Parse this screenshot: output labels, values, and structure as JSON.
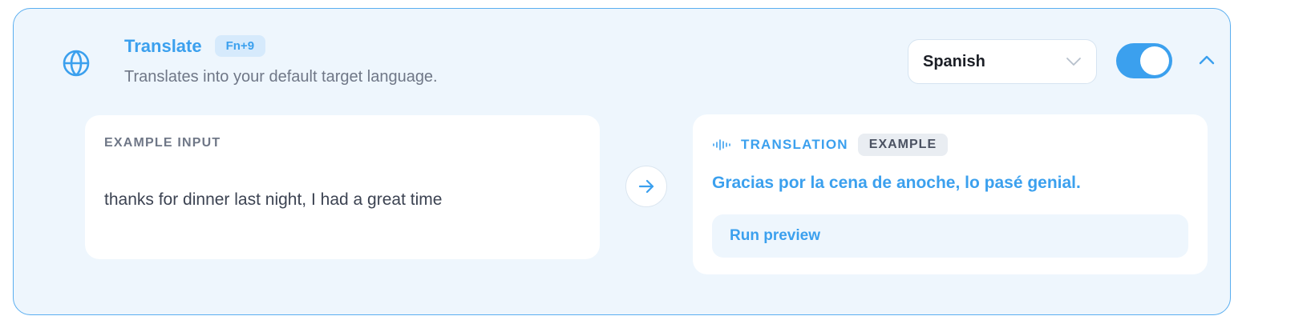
{
  "feature": {
    "title": "Translate",
    "shortcut": "Fn+9",
    "description": "Translates into your default target language.",
    "icon": "globe-icon",
    "enabled": true
  },
  "language_select": {
    "selected": "Spanish"
  },
  "example_input": {
    "label": "EXAMPLE INPUT",
    "text": "thanks for dinner last night, I had a great time"
  },
  "translation": {
    "label": "TRANSLATION",
    "badge": "EXAMPLE",
    "text": "Gracias por la cena de anoche, lo pasé genial.",
    "run_label": "Run preview"
  },
  "colors": {
    "accent": "#3ba0ee",
    "card_bg": "#eef6fd",
    "border": "#5aaef0",
    "muted_text": "#6f7787"
  }
}
